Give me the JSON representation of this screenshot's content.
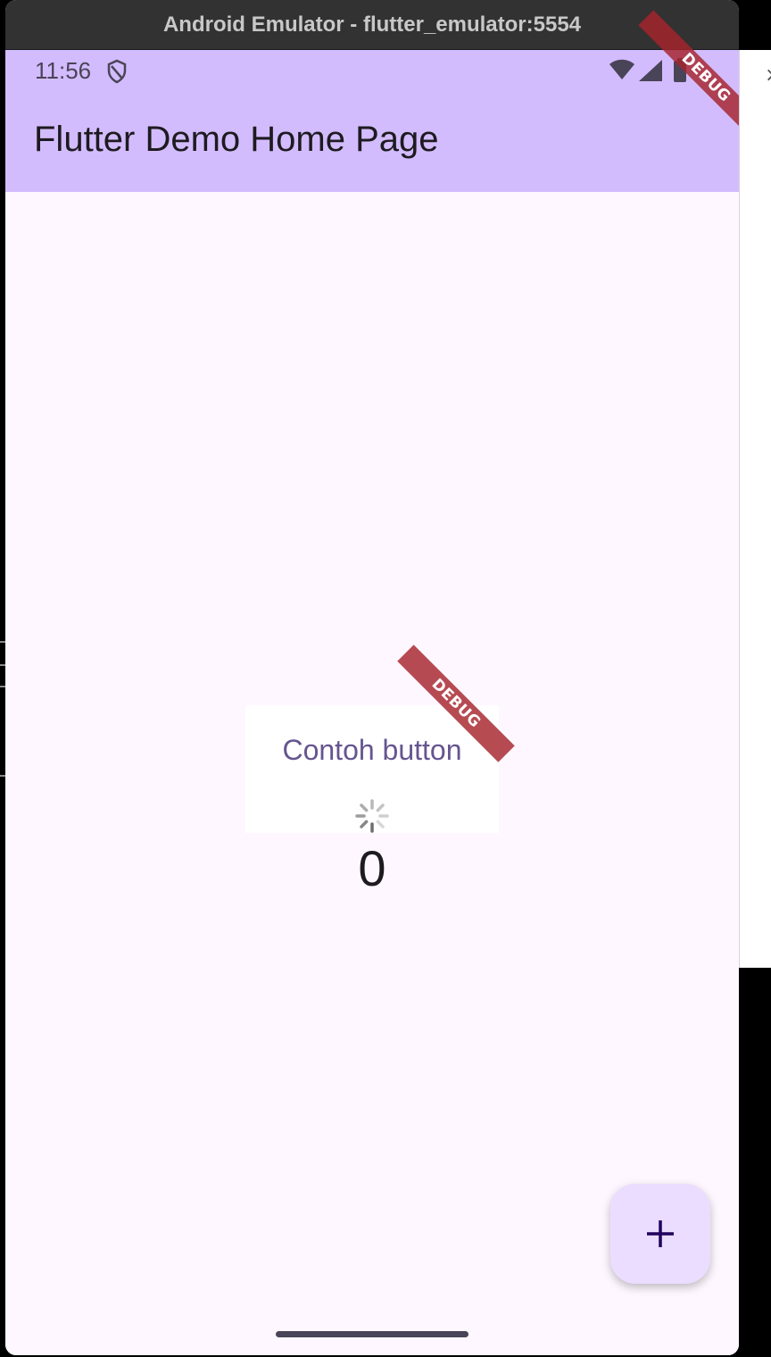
{
  "window": {
    "title": "Android Emulator - flutter_emulator:5554"
  },
  "status_bar": {
    "time": "11:56",
    "icons": [
      "shield-icon",
      "wifi-icon",
      "signal-icon",
      "battery-icon"
    ]
  },
  "app_bar": {
    "title": "Flutter Demo Home Page",
    "color": "#d3bcfd"
  },
  "debug_banner": {
    "label": "DEBUG",
    "color": "#a6232c"
  },
  "main": {
    "button_label": "Contoh button",
    "loading_icon": "spinner-icon",
    "counter": "0"
  },
  "fab": {
    "icon": "plus-icon",
    "color": "#eaddff"
  },
  "background": {
    "surface": "#fef7ff",
    "close_glyph": "×"
  }
}
